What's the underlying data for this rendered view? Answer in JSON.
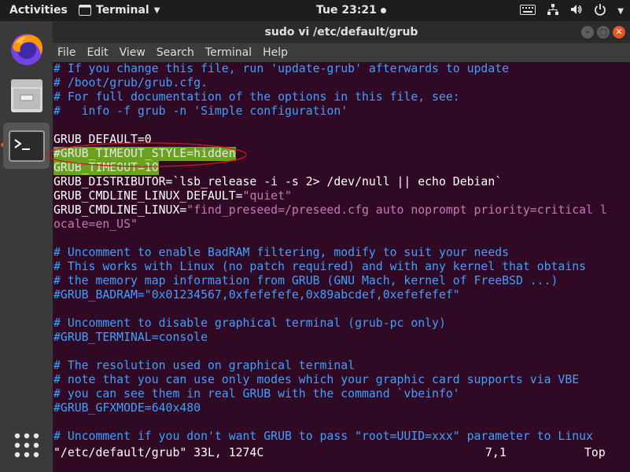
{
  "topbar": {
    "activities": "Activities",
    "app_name": "Terminal",
    "clock": "Tue 23:21"
  },
  "dock": {
    "items": [
      "firefox-icon",
      "files-icon",
      "terminal-icon",
      "show-apps-icon"
    ]
  },
  "window": {
    "title": "sudo vi /etc/default/grub"
  },
  "menubar": [
    "File",
    "Edit",
    "View",
    "Search",
    "Terminal",
    "Help"
  ],
  "terminal": {
    "lines": [
      {
        "cls": "c",
        "text": "# If you change this file, run 'update-grub' afterwards to update"
      },
      {
        "cls": "c",
        "text": "# /boot/grub/grub.cfg."
      },
      {
        "cls": "c",
        "text": "# For full documentation of the options in this file, see:"
      },
      {
        "cls": "c",
        "text": "#   info -f grub -n 'Simple configuration'"
      },
      {
        "cls": "",
        "text": ""
      },
      {
        "cls": "",
        "text": "GRUB_DEFAULT=0"
      },
      {
        "cls": "c hlrow",
        "text": "#GRUB_TIMEOUT_STYLE=hidden"
      },
      {
        "cls": "hlrow",
        "text": "GRUB_TIMEOUT=10"
      },
      {
        "cls": "",
        "text": "GRUB_DISTRIBUTOR=`lsb_release -i -s 2> /dev/null || echo Debian`"
      },
      {
        "cls": "",
        "text": "GRUB_CMDLINE_LINUX_DEFAULT=",
        "str": "\"quiet\""
      },
      {
        "cls": "",
        "text": "GRUB_CMDLINE_LINUX=",
        "str": "\"find_preseed=/preseed.cfg auto noprompt priority=critical l"
      },
      {
        "cls": "s",
        "text": "ocale=en_US\""
      },
      {
        "cls": "",
        "text": ""
      },
      {
        "cls": "c",
        "text": "# Uncomment to enable BadRAM filtering, modify to suit your needs"
      },
      {
        "cls": "c",
        "text": "# This works with Linux (no patch required) and with any kernel that obtains"
      },
      {
        "cls": "c",
        "text": "# the memory map information from GRUB (GNU Mach, kernel of FreeBSD ...)"
      },
      {
        "cls": "c",
        "text": "#GRUB_BADRAM=\"0x01234567,0xfefefefe,0x89abcdef,0xefefefef\""
      },
      {
        "cls": "",
        "text": ""
      },
      {
        "cls": "c",
        "text": "# Uncomment to disable graphical terminal (grub-pc only)"
      },
      {
        "cls": "c",
        "text": "#GRUB_TERMINAL=console"
      },
      {
        "cls": "",
        "text": ""
      },
      {
        "cls": "c",
        "text": "# The resolution used on graphical terminal"
      },
      {
        "cls": "c",
        "text": "# note that you can use only modes which your graphic card supports via VBE"
      },
      {
        "cls": "c",
        "text": "# you can see them in real GRUB with the command `vbeinfo'"
      },
      {
        "cls": "c",
        "text": "#GRUB_GFXMODE=640x480"
      },
      {
        "cls": "",
        "text": ""
      },
      {
        "cls": "c",
        "text": "# Uncomment if you don't want GRUB to pass \"root=UUID=xxx\" parameter to Linux"
      }
    ],
    "status": {
      "file": "\"/etc/default/grub\" 33L, 1274C",
      "position": "7,1",
      "scroll": "Top"
    }
  }
}
